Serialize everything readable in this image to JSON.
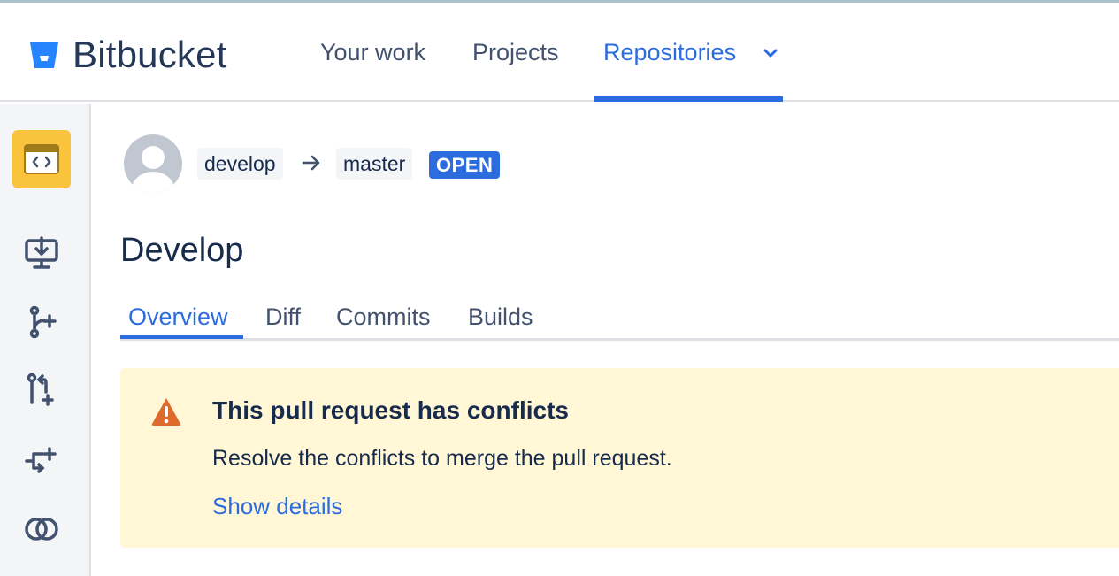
{
  "header": {
    "brand": "Bitbucket",
    "nav": [
      "Your work",
      "Projects",
      "Repositories"
    ]
  },
  "pull_request": {
    "source_branch": "develop",
    "target_branch": "master",
    "status": "OPEN",
    "title": "Develop"
  },
  "tabs": [
    "Overview",
    "Diff",
    "Commits",
    "Builds"
  ],
  "alert": {
    "title": "This pull request has conflicts",
    "message": "Resolve the conflicts to merge the pull request.",
    "link": "Show details"
  },
  "colors": {
    "accent": "#2d6cdf",
    "warning_bg": "#fff7d6",
    "warning_icon": "#de6b2c",
    "repo_avatar": "#f9c33c"
  }
}
